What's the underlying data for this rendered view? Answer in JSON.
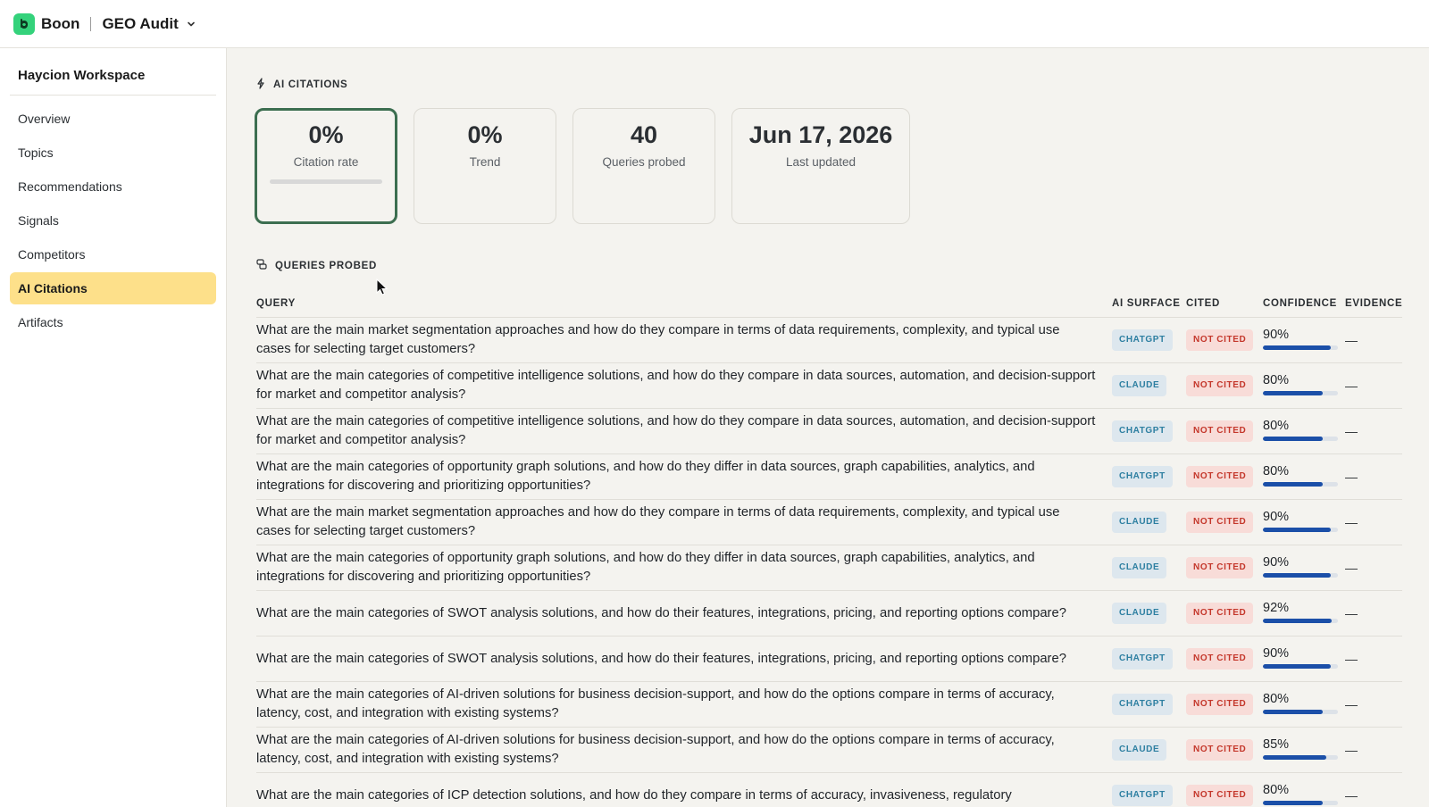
{
  "header": {
    "brand": "Boon",
    "app_title": "GEO Audit"
  },
  "sidebar": {
    "workspace": "Haycion Workspace",
    "items": [
      {
        "label": "Overview"
      },
      {
        "label": "Topics"
      },
      {
        "label": "Recommendations"
      },
      {
        "label": "Signals"
      },
      {
        "label": "Competitors"
      },
      {
        "label": "AI Citations",
        "active": true
      },
      {
        "label": "Artifacts"
      }
    ]
  },
  "main": {
    "citations_label": "AI CITATIONS",
    "cards": [
      {
        "value": "0%",
        "label": "Citation rate",
        "progress": 0
      },
      {
        "value": "0%",
        "label": "Trend"
      },
      {
        "value": "40",
        "label": "Queries probed"
      },
      {
        "value": "Jun 17, 2026",
        "label": "Last updated"
      }
    ],
    "queries_label": "QUERIES PROBED",
    "table": {
      "headers": {
        "query": "QUERY",
        "surface": "AI SURFACE",
        "cited": "CITED",
        "confidence": "CONFIDENCE",
        "evidence": "EVIDENCE"
      },
      "rows": [
        {
          "query": "What are the main market segmentation approaches and how do they compare in terms of data requirements, complexity, and typical use cases for selecting target customers?",
          "surface": "CHATGPT",
          "cited": "NOT CITED",
          "confidence": "90%",
          "conf_pct": 90,
          "evidence": "—"
        },
        {
          "query": "What are the main categories of competitive intelligence solutions, and how do they compare in data sources, automation, and decision-support for market and competitor analysis?",
          "surface": "CLAUDE",
          "cited": "NOT CITED",
          "confidence": "80%",
          "conf_pct": 80,
          "evidence": "—"
        },
        {
          "query": "What are the main categories of competitive intelligence solutions, and how do they compare in data sources, automation, and decision-support for market and competitor analysis?",
          "surface": "CHATGPT",
          "cited": "NOT CITED",
          "confidence": "80%",
          "conf_pct": 80,
          "evidence": "—"
        },
        {
          "query": "What are the main categories of opportunity graph solutions, and how do they differ in data sources, graph capabilities, analytics, and integrations for discovering and prioritizing opportunities?",
          "surface": "CHATGPT",
          "cited": "NOT CITED",
          "confidence": "80%",
          "conf_pct": 80,
          "evidence": "—"
        },
        {
          "query": "What are the main market segmentation approaches and how do they compare in terms of data requirements, complexity, and typical use cases for selecting target customers?",
          "surface": "CLAUDE",
          "cited": "NOT CITED",
          "confidence": "90%",
          "conf_pct": 90,
          "evidence": "—"
        },
        {
          "query": "What are the main categories of opportunity graph solutions, and how do they differ in data sources, graph capabilities, analytics, and integrations for discovering and prioritizing opportunities?",
          "surface": "CLAUDE",
          "cited": "NOT CITED",
          "confidence": "90%",
          "conf_pct": 90,
          "evidence": "—"
        },
        {
          "query": "What are the main categories of SWOT analysis solutions, and how do their features, integrations, pricing, and reporting options compare?",
          "surface": "CLAUDE",
          "cited": "NOT CITED",
          "confidence": "92%",
          "conf_pct": 92,
          "evidence": "—"
        },
        {
          "query": "What are the main categories of SWOT analysis solutions, and how do their features, integrations, pricing, and reporting options compare?",
          "surface": "CHATGPT",
          "cited": "NOT CITED",
          "confidence": "90%",
          "conf_pct": 90,
          "evidence": "—"
        },
        {
          "query": "What are the main categories of AI-driven solutions for business decision-support, and how do the options compare in terms of accuracy, latency, cost, and integration with existing systems?",
          "surface": "CHATGPT",
          "cited": "NOT CITED",
          "confidence": "80%",
          "conf_pct": 80,
          "evidence": "—"
        },
        {
          "query": "What are the main categories of AI-driven solutions for business decision-support, and how do the options compare in terms of accuracy, latency, cost, and integration with existing systems?",
          "surface": "CLAUDE",
          "cited": "NOT CITED",
          "confidence": "85%",
          "conf_pct": 85,
          "evidence": "—"
        },
        {
          "query": "What are the main categories of ICP detection solutions, and how do they compare in terms of accuracy, invasiveness, regulatory",
          "surface": "CHATGPT",
          "cited": "NOT CITED",
          "confidence": "80%",
          "conf_pct": 80,
          "evidence": "—"
        }
      ]
    }
  },
  "colors": {
    "brand_green": "#34d27b",
    "active_nav": "#fde08a",
    "selected_card_border": "#3c6e50",
    "confidence_bar": "#1b4fa8",
    "surface_pill_text": "#2d7fa1",
    "cited_pill_text": "#c4372b"
  },
  "icons": {
    "logo": "logo-icon",
    "chevron": "chevron-down-icon",
    "citations": "lightning-icon",
    "queries": "queries-icon",
    "cursor": "mouse-pointer-icon"
  }
}
